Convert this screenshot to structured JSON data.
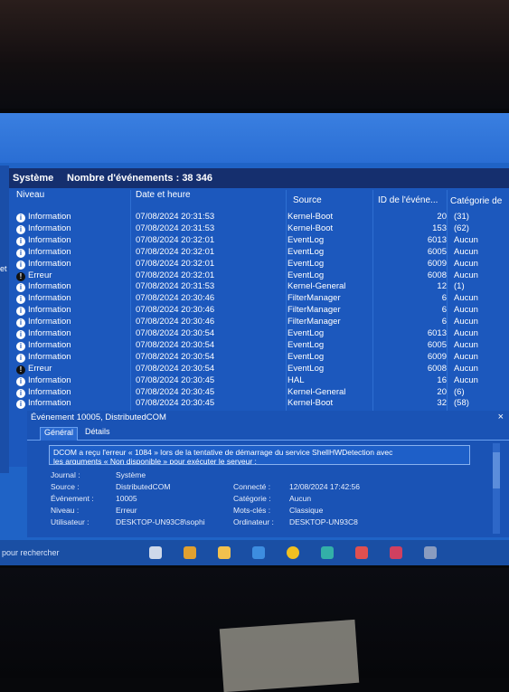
{
  "panel": {
    "title": "Système",
    "count_label": "Nombre d'événements : 38 346"
  },
  "columns": {
    "level": "Niveau",
    "datetime": "Date et heure",
    "source": "Source",
    "event_id": "ID de l'événe...",
    "category": "Catégorie de"
  },
  "left_strip_text": "et",
  "rows": [
    {
      "level": "Information",
      "datetime": "07/08/2024 20:31:53",
      "source": "Kernel-Boot",
      "id": "20",
      "category": "(31)"
    },
    {
      "level": "Information",
      "datetime": "07/08/2024 20:31:53",
      "source": "Kernel-Boot",
      "id": "153",
      "category": "(62)"
    },
    {
      "level": "Information",
      "datetime": "07/08/2024 20:32:01",
      "source": "EventLog",
      "id": "6013",
      "category": "Aucun"
    },
    {
      "level": "Information",
      "datetime": "07/08/2024 20:32:01",
      "source": "EventLog",
      "id": "6005",
      "category": "Aucun"
    },
    {
      "level": "Information",
      "datetime": "07/08/2024 20:32:01",
      "source": "EventLog",
      "id": "6009",
      "category": "Aucun"
    },
    {
      "level": "Erreur",
      "datetime": "07/08/2024 20:32:01",
      "source": "EventLog",
      "id": "6008",
      "category": "Aucun"
    },
    {
      "level": "Information",
      "datetime": "07/08/2024 20:31:53",
      "source": "Kernel-General",
      "id": "12",
      "category": "(1)"
    },
    {
      "level": "Information",
      "datetime": "07/08/2024 20:30:46",
      "source": "FilterManager",
      "id": "6",
      "category": "Aucun"
    },
    {
      "level": "Information",
      "datetime": "07/08/2024 20:30:46",
      "source": "FilterManager",
      "id": "6",
      "category": "Aucun"
    },
    {
      "level": "Information",
      "datetime": "07/08/2024 20:30:46",
      "source": "FilterManager",
      "id": "6",
      "category": "Aucun"
    },
    {
      "level": "Information",
      "datetime": "07/08/2024 20:30:54",
      "source": "EventLog",
      "id": "6013",
      "category": "Aucun"
    },
    {
      "level": "Information",
      "datetime": "07/08/2024 20:30:54",
      "source": "EventLog",
      "id": "6005",
      "category": "Aucun"
    },
    {
      "level": "Information",
      "datetime": "07/08/2024 20:30:54",
      "source": "EventLog",
      "id": "6009",
      "category": "Aucun"
    },
    {
      "level": "Erreur",
      "datetime": "07/08/2024 20:30:54",
      "source": "EventLog",
      "id": "6008",
      "category": "Aucun"
    },
    {
      "level": "Information",
      "datetime": "07/08/2024 20:30:45",
      "source": "HAL",
      "id": "16",
      "category": "Aucun"
    },
    {
      "level": "Information",
      "datetime": "07/08/2024 20:30:45",
      "source": "Kernel-General",
      "id": "20",
      "category": "(6)"
    },
    {
      "level": "Information",
      "datetime": "07/08/2024 20:30:45",
      "source": "Kernel-Boot",
      "id": "32",
      "category": "(58)"
    }
  ],
  "icons": {
    "info": "info-icon",
    "error": "error-icon"
  },
  "detail": {
    "title": "Événement 10005, DistributedCOM",
    "close": "×",
    "tabs": [
      "Général",
      "Détails"
    ],
    "message_line1": "DCOM a reçu l'erreur « 1084 » lors de la tentative de démarrage du service ShellHWDetection avec",
    "message_line2": "les arguments « Non disponible » pour exécuter le serveur :",
    "props": {
      "journal_label": "Journal :",
      "journal_value": "Système",
      "source_label": "Source :",
      "source_value": "DistributedCOM",
      "event_label": "Événement :",
      "event_value": "10005",
      "level_label": "Niveau :",
      "level_value": "Erreur",
      "user_label": "Utilisateur :",
      "user_value": "DESKTOP-UN93C8\\sophi",
      "logged_label": "Connecté :",
      "logged_value": "12/08/2024 17:42:56",
      "category_label": "Catégorie :",
      "category_value": "Aucun",
      "keywords_label": "Mots-clés :",
      "keywords_value": "Classique",
      "computer_label": "Ordinateur :",
      "computer_value": "DESKTOP-UN93C8"
    }
  },
  "taskbar": {
    "search_text": "pour rechercher",
    "icons": [
      {
        "name": "task-view-icon",
        "color": "#cfd9ea"
      },
      {
        "name": "widgets-icon",
        "color": "#e0a030"
      },
      {
        "name": "file-explorer-icon",
        "color": "#f2c14e"
      },
      {
        "name": "mail-icon",
        "color": "#3d8de0"
      },
      {
        "name": "chrome-icon",
        "color": "#f0c020"
      },
      {
        "name": "edge-icon",
        "color": "#33b0a8"
      },
      {
        "name": "store-icon",
        "color": "#e05050"
      },
      {
        "name": "app-icon",
        "color": "#d04060"
      },
      {
        "name": "settings-icon",
        "color": "#8a9cc0"
      }
    ]
  }
}
